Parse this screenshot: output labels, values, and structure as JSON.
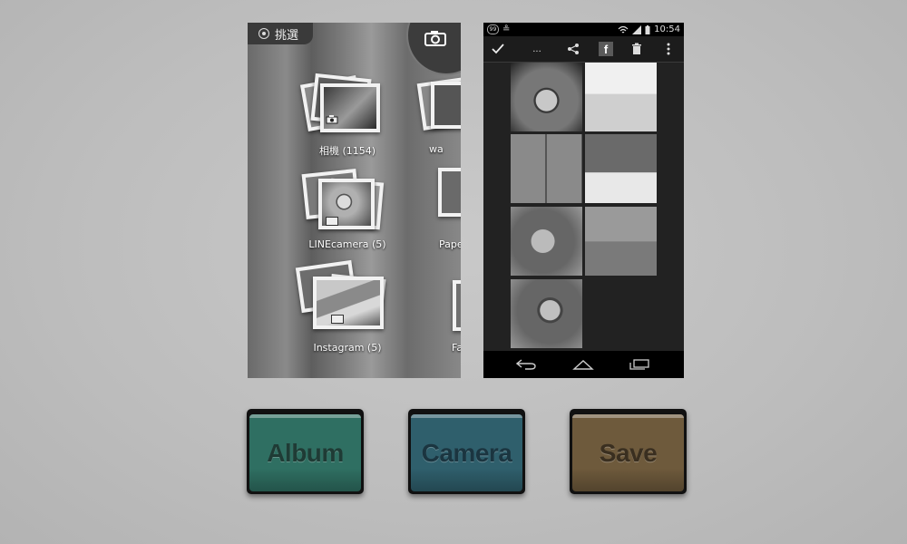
{
  "gallery": {
    "pick_label": "挑選",
    "albums": [
      {
        "label": "相機  (1154)"
      },
      {
        "label": "wa"
      },
      {
        "label": "LINEcamera  (5)"
      },
      {
        "label": "Pape"
      },
      {
        "label": "Instagram  (5)"
      },
      {
        "label": "Fa"
      }
    ]
  },
  "phone": {
    "status": {
      "notification_count": "99",
      "time": "10:54"
    },
    "actionbar": {
      "overflow_label": "..."
    }
  },
  "buttons": [
    {
      "label": "Album",
      "color": "#2f6f62",
      "text_color": "#1f3b35"
    },
    {
      "label": "Camera",
      "color": "#2f5f6c",
      "text_color": "#1b3540"
    },
    {
      "label": "Save",
      "color": "#6e5a3c",
      "text_color": "#3a2f20"
    }
  ]
}
